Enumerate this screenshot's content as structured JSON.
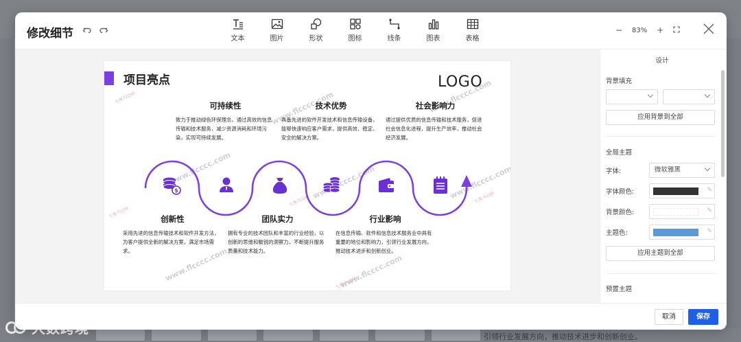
{
  "modal": {
    "title": "修改细节",
    "toolbar": [
      {
        "label": "文本",
        "icon": "text-icon"
      },
      {
        "label": "图片",
        "icon": "image-icon"
      },
      {
        "label": "形状",
        "icon": "shape-icon"
      },
      {
        "label": "图标",
        "icon": "icons-icon"
      },
      {
        "label": "线条",
        "icon": "line-icon"
      },
      {
        "label": "图表",
        "icon": "chart-icon"
      },
      {
        "label": "表格",
        "icon": "table-icon"
      }
    ],
    "zoom": {
      "minus": "−",
      "value": "83%",
      "plus": "+"
    },
    "footer": {
      "cancel": "取消",
      "save": "保存"
    }
  },
  "slide": {
    "title": "项目亮点",
    "logo": "LOGO",
    "accent_color": "#7b3fe4",
    "watermark": "www.flcccc.com",
    "watermark_flow": "七淘 FLOW",
    "top_items": [
      {
        "title": "可持续性",
        "text": "致力于推动绿色环保理念，通过高效的信息传输和技术服务，减少资源消耗和环境污染，实现可持续发展。"
      },
      {
        "title": "技术优势",
        "text": "具备先进的软件开发技术和信息传输设备，能够快速响应客户需求，提供高效、稳定、安全的解决方案。"
      },
      {
        "title": "社会影响力",
        "text": "通过提供优质的信息传输和技术服务，促进社会信息化进程，提升生产效率，推动社会经济发展。"
      }
    ],
    "bottom_items": [
      {
        "title": "创新性",
        "text": "采用先进的信息传输技术和软件开发方法，为客户提供全新的解决方案，满足市场需求。"
      },
      {
        "title": "团队实力",
        "text": "拥有专业的技术团队和丰富的行业经验，以创新的思维和敏锐的洞察力，不断提升服务质量和技术能力。"
      },
      {
        "title": "行业影响",
        "text": "在信息传输、软件和信息技术服务业中具有重要的地位和影响力，引领行业发展方向，推动技术进步和创新创业。"
      }
    ]
  },
  "panel": {
    "title": "设计",
    "bg_fill_label": "背景填充",
    "apply_bg_all": "应用背景到全部",
    "global_theme_label": "全局主题",
    "font_label": "字体:",
    "font_value": "微软雅黑",
    "font_color_label": "字体颜色:",
    "font_color": "#333333",
    "bg_color_label": "背景颜色:",
    "bg_color": "#ffffff",
    "theme_color_label": "主题色:",
    "theme_color": "#5b9bd5",
    "apply_theme_all": "应用主题到全部",
    "preset_theme_label": "预置主题"
  },
  "background": {
    "brand": "大数跨境",
    "bottom_text": "引领行业发展方向，推动技术进步和创新创业。"
  }
}
